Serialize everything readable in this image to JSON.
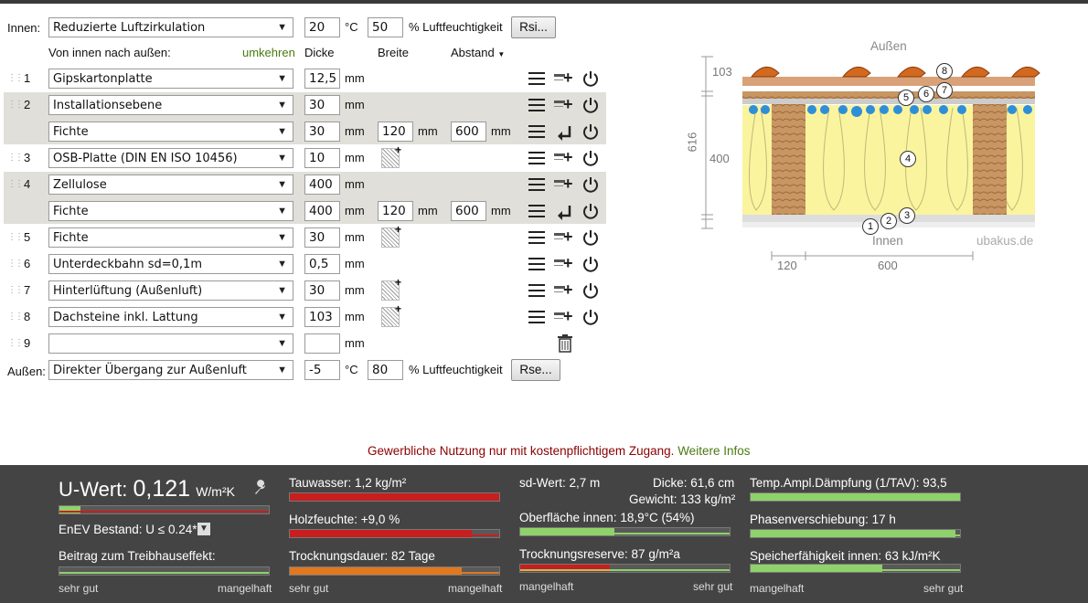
{
  "inside": {
    "label": "Innen:",
    "climate": "Reduzierte Luftzirkulation",
    "temp": "20",
    "temp_unit": "°C",
    "humidity": "50",
    "humidity_label": "% Luftfeuchtigkeit",
    "rsi_button": "Rsi..."
  },
  "header": {
    "direction": "Von innen nach außen:",
    "reverse": "umkehren",
    "thickness": "Dicke",
    "width": "Breite",
    "distance": "Abstand"
  },
  "layers": [
    {
      "num": "1",
      "material": "Gipskartonplatte",
      "thickness": "12,5",
      "unit": "mm"
    },
    {
      "num": "2",
      "material": "Installationsebene",
      "thickness": "30",
      "unit": "mm",
      "sub": {
        "material": "Fichte",
        "thickness": "30",
        "unit": "mm",
        "width": "120",
        "width_unit": "mm",
        "distance": "600",
        "distance_unit": "mm"
      }
    },
    {
      "num": "3",
      "material": "OSB-Platte (DIN EN ISO 10456)",
      "thickness": "10",
      "unit": "mm"
    },
    {
      "num": "4",
      "material": "Zellulose",
      "thickness": "400",
      "unit": "mm",
      "sub": {
        "material": "Fichte",
        "thickness": "400",
        "unit": "mm",
        "width": "120",
        "width_unit": "mm",
        "distance": "600",
        "distance_unit": "mm"
      }
    },
    {
      "num": "5",
      "material": "Fichte",
      "thickness": "30",
      "unit": "mm"
    },
    {
      "num": "6",
      "material": "Unterdeckbahn sd=0,1m",
      "thickness": "0,5",
      "unit": "mm"
    },
    {
      "num": "7",
      "material": "Hinterlüftung (Außenluft)",
      "thickness": "30",
      "unit": "mm"
    },
    {
      "num": "8",
      "material": "Dachsteine inkl. Lattung",
      "thickness": "103",
      "unit": "mm"
    },
    {
      "num": "9",
      "material": "",
      "thickness": "",
      "unit": "mm"
    }
  ],
  "outside": {
    "label": "Außen:",
    "climate": "Direkter Übergang zur Außenluft",
    "temp": "-5",
    "temp_unit": "°C",
    "humidity": "80",
    "humidity_label": "% Luftfeuchtigkeit",
    "rse_button": "Rse..."
  },
  "diagram": {
    "outside_label": "Außen",
    "inside_label": "Innen",
    "watermark": "ubakus.de",
    "dim_top": "103",
    "dim_mid": "400",
    "dim_total": "616",
    "dim_width": "120",
    "dim_distance": "600",
    "markers": [
      "1",
      "2",
      "3",
      "4",
      "5",
      "6",
      "7",
      "8"
    ]
  },
  "notice": {
    "text": "Gewerbliche Nutzung nur mit kostenpflichtigem Zugang.",
    "link": "Weitere Infos"
  },
  "results": {
    "uvalue_label": "U-Wert:",
    "uvalue": "0,121",
    "uvalue_unit": "W/m²K",
    "enev": "EnEV Bestand: U ≤ 0.24*",
    "greenhouse": "Beitrag zum Treibhauseffekt:",
    "tauwasser": "Tauwasser: 1,2 kg/m²",
    "holzfeuchte": "Holzfeuchte: +9,0 %",
    "trocknung": "Trocknungsdauer: 82 Tage",
    "sdwert": "sd-Wert: 2,7 m",
    "dicke": "Dicke: 61,6 cm",
    "gewicht": "Gewicht: 133 kg/m²",
    "oberflaeche": "Oberfläche innen: 18,9°C (54%)",
    "trocknungsreserve": "Trocknungsreserve: 87 g/m²a",
    "tav": "Temp.Ampl.Dämpfung (1/TAV): 93,5",
    "phase": "Phasenverschiebung: 17 h",
    "speicher": "Speicherfähigkeit innen: 63 kJ/m²K",
    "scale_good": "sehr gut",
    "scale_bad": "mangelhaft",
    "scale_bad2": "mangelhaft",
    "scale_good2": "sehr gut",
    "u_fraction": 0.1,
    "tauwasser_fraction": 1.0,
    "holzfeuchte_fraction": 0.87,
    "trocknung_fraction": 0.82,
    "oberflaeche_fraction": 0.45,
    "reserve_fraction": 0.43,
    "tav_fraction": 1.0,
    "phase_fraction": 0.98,
    "speicher_fraction": 0.63,
    "colors": {
      "green": "#8fd16a",
      "red": "#c81e1e",
      "orange": "#e07820"
    }
  }
}
